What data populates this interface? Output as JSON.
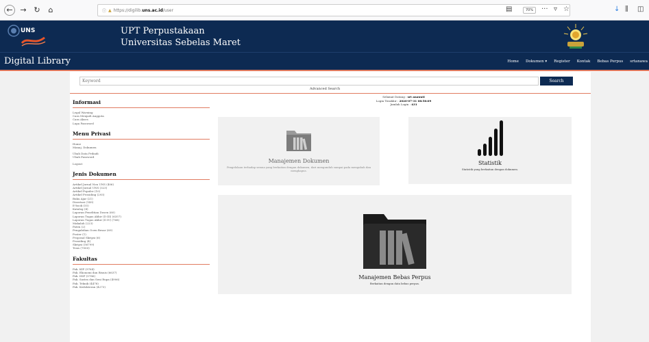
{
  "browser": {
    "url_prefix": "https://digilib.",
    "url_host": "uns.ac.id",
    "url_path": "/user",
    "zoom": "70%"
  },
  "header": {
    "logo_text": "UNS",
    "title_line1": "UPT Perpustakaan",
    "title_line2": "Universitas Sebelas Maret"
  },
  "navbar": {
    "brand": "Digital Library",
    "items": [
      "Home",
      "Dokumen ▾",
      "Register",
      "Kontak",
      "Bebas Perpus",
      "srtanawa"
    ]
  },
  "search": {
    "placeholder": "Keyword",
    "button": "Search",
    "advanced": "Advanced Search"
  },
  "welcome": {
    "line1_label": "Selamat Datang :",
    "line1_value": "srt anawati",
    "line2_label": "Login Terakhir :",
    "line2_value": "2020-07-31 08:58:09",
    "line3_label": "Jumlah Login :",
    "line3_value": "431"
  },
  "sidebar": {
    "informasi": {
      "title": "Informasi",
      "items": [
        "Legal Warning",
        "Cara Menjadi Anggota",
        "Cara Akses",
        "Lupa Password"
      ]
    },
    "menu_privasi": {
      "title": "Menu Privasi",
      "group1": [
        "Home",
        "Manaj. Dokumen"
      ],
      "group2": [
        "Ubah Data Pribadi",
        "Ubah Password"
      ],
      "group3": [
        "Logout"
      ]
    },
    "jenis_dokumen": {
      "title": "Jenis Dokumen",
      "items": [
        "Artikel Jurnal Non UNS (406)",
        "Artikel Jurnal UNS (323)",
        "Artikel Populer (10)",
        "Artikel Prosiding (293)",
        "Buku Ajar (21)",
        "Disertasi (149)",
        "E-book (55)",
        "Katalog (4)",
        "Laporan Penelitian Dosen (60)",
        "Laporan Tugas Akhir (D III) (6357)",
        "Laporan Tugas Akhir (D IV) (768)",
        "Makalah (223)",
        "Paten (2)",
        "Pengabdian Ooen Besar (69)",
        "Poster (1)",
        "Proposal Skripsi (6)",
        "Prosiding (4)",
        "Skripsi (56799)",
        "Tesis (7000)"
      ]
    },
    "fakultas": {
      "title": "Fakultas",
      "items": [
        "Fak. KIP (9764)",
        "Fak. Ekonomi dan Bisnis (6637)",
        "Fak. ISIP (5786)",
        "Fak. Sastra dan Seni Rupa (4906)",
        "Fak. Teknik (4478)",
        "Fak. Kedokteran (4273)"
      ]
    }
  },
  "cards": {
    "dokumen": {
      "title": "Manajemen Dokumen",
      "desc": "Pengelolaan terhadap semua yang berkaitan dengan dokumen, dari mengunduh sampai pada mengubah dan menghapus."
    },
    "statistik": {
      "title": "Statistik",
      "desc": "Statistik yang berkaitan dengan dokumen."
    },
    "bebas": {
      "title": "Manajemen Bebas Perpus",
      "desc": "Berkaitan dengan data bebas perpus."
    }
  },
  "colors": {
    "navy": "#0d2a52",
    "accent": "#e07a5f",
    "card_bg": "#f1f1f1"
  }
}
